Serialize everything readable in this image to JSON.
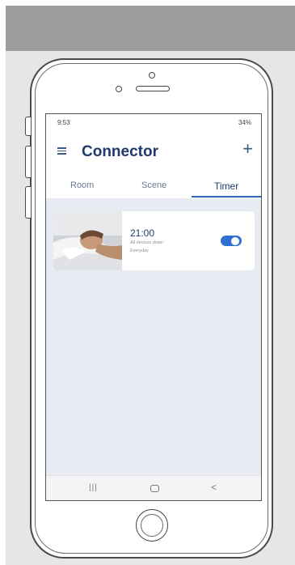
{
  "status_bar": {
    "time": "9:53",
    "right": "34%"
  },
  "header": {
    "title": "Connector",
    "menu_icon": "hamburger-menu-icon",
    "add_icon": "plus-icon",
    "add_glyph": "+"
  },
  "tabs": [
    {
      "label": "Room",
      "active": false
    },
    {
      "label": "Scene",
      "active": false
    },
    {
      "label": "Timer",
      "active": true
    }
  ],
  "timer_card": {
    "time": "21:00",
    "description": "All devices down",
    "repeat": "Everyday",
    "enabled": true,
    "image": "sleeping-person-photo"
  },
  "nav_bar": {
    "recent_glyph": "|||",
    "back_glyph": "<"
  },
  "colors": {
    "accent": "#2f6fd0",
    "title": "#1f3a6b",
    "screen_bg": "#e7ebf2"
  }
}
